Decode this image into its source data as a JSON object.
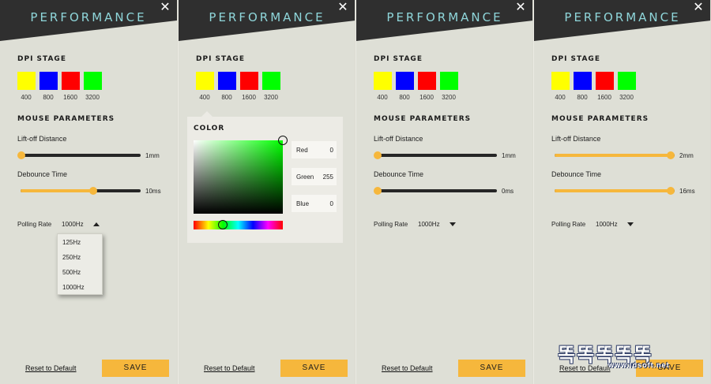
{
  "colors": {
    "accent": "#f6b73c",
    "header": "#2f2f2f",
    "title": "#8fd6da",
    "background": "#dedfd6"
  },
  "icons": {
    "close": "close-icon",
    "caret": "caret-icon"
  },
  "common": {
    "title": "PERFORMANCE",
    "close_glyph": "✕",
    "dpi_stage": "DPI STAGE",
    "mouse_parameters": "MOUSE PARAMETERS",
    "liftoff_label": "Lift-off Distance",
    "debounce_label": "Debounce Time",
    "polling_label": "Polling Rate",
    "reset_label": "Reset to Default",
    "save_label": "SAVE",
    "dpi": [
      {
        "label": "400",
        "color": "#ffff00"
      },
      {
        "label": "800",
        "color": "#0000ff"
      },
      {
        "label": "1600",
        "color": "#ff0000"
      },
      {
        "label": "3200",
        "color": "#00ff00"
      }
    ]
  },
  "panels": [
    {
      "liftoff": {
        "value_label": "1mm",
        "level": 0.0
      },
      "debounce": {
        "value_label": "10ms",
        "level": 0.62
      },
      "polling": {
        "value": "1000Hz",
        "open": true,
        "options": [
          "125Hz",
          "250Hz",
          "500Hz",
          "1000Hz"
        ]
      }
    },
    {
      "color_picker": {
        "title": "COLOR",
        "fields": [
          {
            "name": "Red",
            "value": "0"
          },
          {
            "name": "Green",
            "value": "255"
          },
          {
            "name": "Blue",
            "value": "0"
          }
        ],
        "hue_level": 0.33,
        "saturation": 1.0,
        "brightness": 1.0
      }
    },
    {
      "liftoff": {
        "value_label": "1mm",
        "level": 0.0
      },
      "debounce": {
        "value_label": "0ms",
        "level": 0.0
      },
      "polling": {
        "value": "1000Hz",
        "open": false
      }
    },
    {
      "liftoff": {
        "value_label": "2mm",
        "level": 1.0
      },
      "debounce": {
        "value_label": "16ms",
        "level": 1.0
      },
      "polling": {
        "value": "1000Hz",
        "open": false
      }
    }
  ],
  "watermark": {
    "text": "똑똑똑똑똑",
    "url": "www.ldsoft.net"
  }
}
